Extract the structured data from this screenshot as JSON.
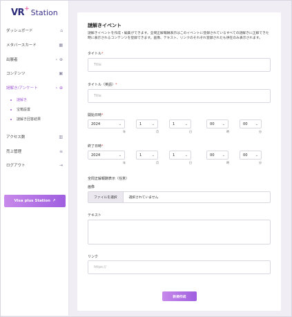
{
  "brand": {
    "logo_vr": "VR",
    "logo_plus": "+",
    "logo_word": "Station"
  },
  "sidebar": {
    "items": [
      {
        "label": "ダッシュボード",
        "icon": "home-icon",
        "glyph": "⌂"
      },
      {
        "label": "メタバースカード",
        "icon": "calendar-icon",
        "glyph": "▦"
      },
      {
        "label": "出展者",
        "icon": "plus-circle-icon",
        "glyph": "⊕",
        "chevron": "‹"
      },
      {
        "label": "コンテンツ",
        "icon": "folder-icon",
        "glyph": "▣"
      },
      {
        "label": "謎解き/アンケート",
        "icon": "plus-circle-icon",
        "glyph": "⊕",
        "chevron": "‹"
      },
      {
        "label": "アクセス数",
        "icon": "bar-chart-icon",
        "glyph": "▥"
      },
      {
        "label": "売上管理",
        "icon": "money-icon",
        "glyph": "≡"
      },
      {
        "label": "ログアウト",
        "icon": "logout-icon",
        "glyph": "⇥"
      }
    ],
    "subitems": [
      "謎解き",
      "宝箱設置",
      "謎解き回答結果"
    ],
    "button_label": "Visa plus Station",
    "button_icon": "↗"
  },
  "form": {
    "title": "謎解きイベント",
    "description": "謎解きイベントを作成・編集ができます。全問正解報酬表示はこのイベントに登録されているすべての謎解きに正解できた時に表示されるコンテンツを登録できます。画像、テキスト、リンクのそれぞれ登録されたも併在のみ表示されます。",
    "title_label": "タイトル",
    "title_placeholder": "Title",
    "title_en_label": "タイトル（英語）",
    "title_en_placeholder": "Title",
    "required_mark": "*",
    "start_label": "開始日時",
    "end_label": "終了日時",
    "start": {
      "year": "2024",
      "month": "1",
      "day": "1",
      "hour": "00",
      "minute": "00"
    },
    "end": {
      "year": "2024",
      "month": "1",
      "day": "1",
      "hour": "00",
      "minute": "00"
    },
    "units": {
      "year": "年",
      "month": "月",
      "day": "日",
      "hour": "時",
      "minute": "分"
    },
    "reward_label": "全問正解報酬表示（任意）",
    "image_label": "画像",
    "file_button": "ファイルを選択",
    "file_status": "選択されていません",
    "text_label": "テキスト",
    "link_label": "リンク",
    "link_placeholder": "https://",
    "submit_label": "新規作成"
  },
  "colors": {
    "accent": "#a05bd6",
    "button_gradient_start": "#c789ea",
    "button_gradient_end": "#9f5fe0",
    "required": "#e05555"
  }
}
